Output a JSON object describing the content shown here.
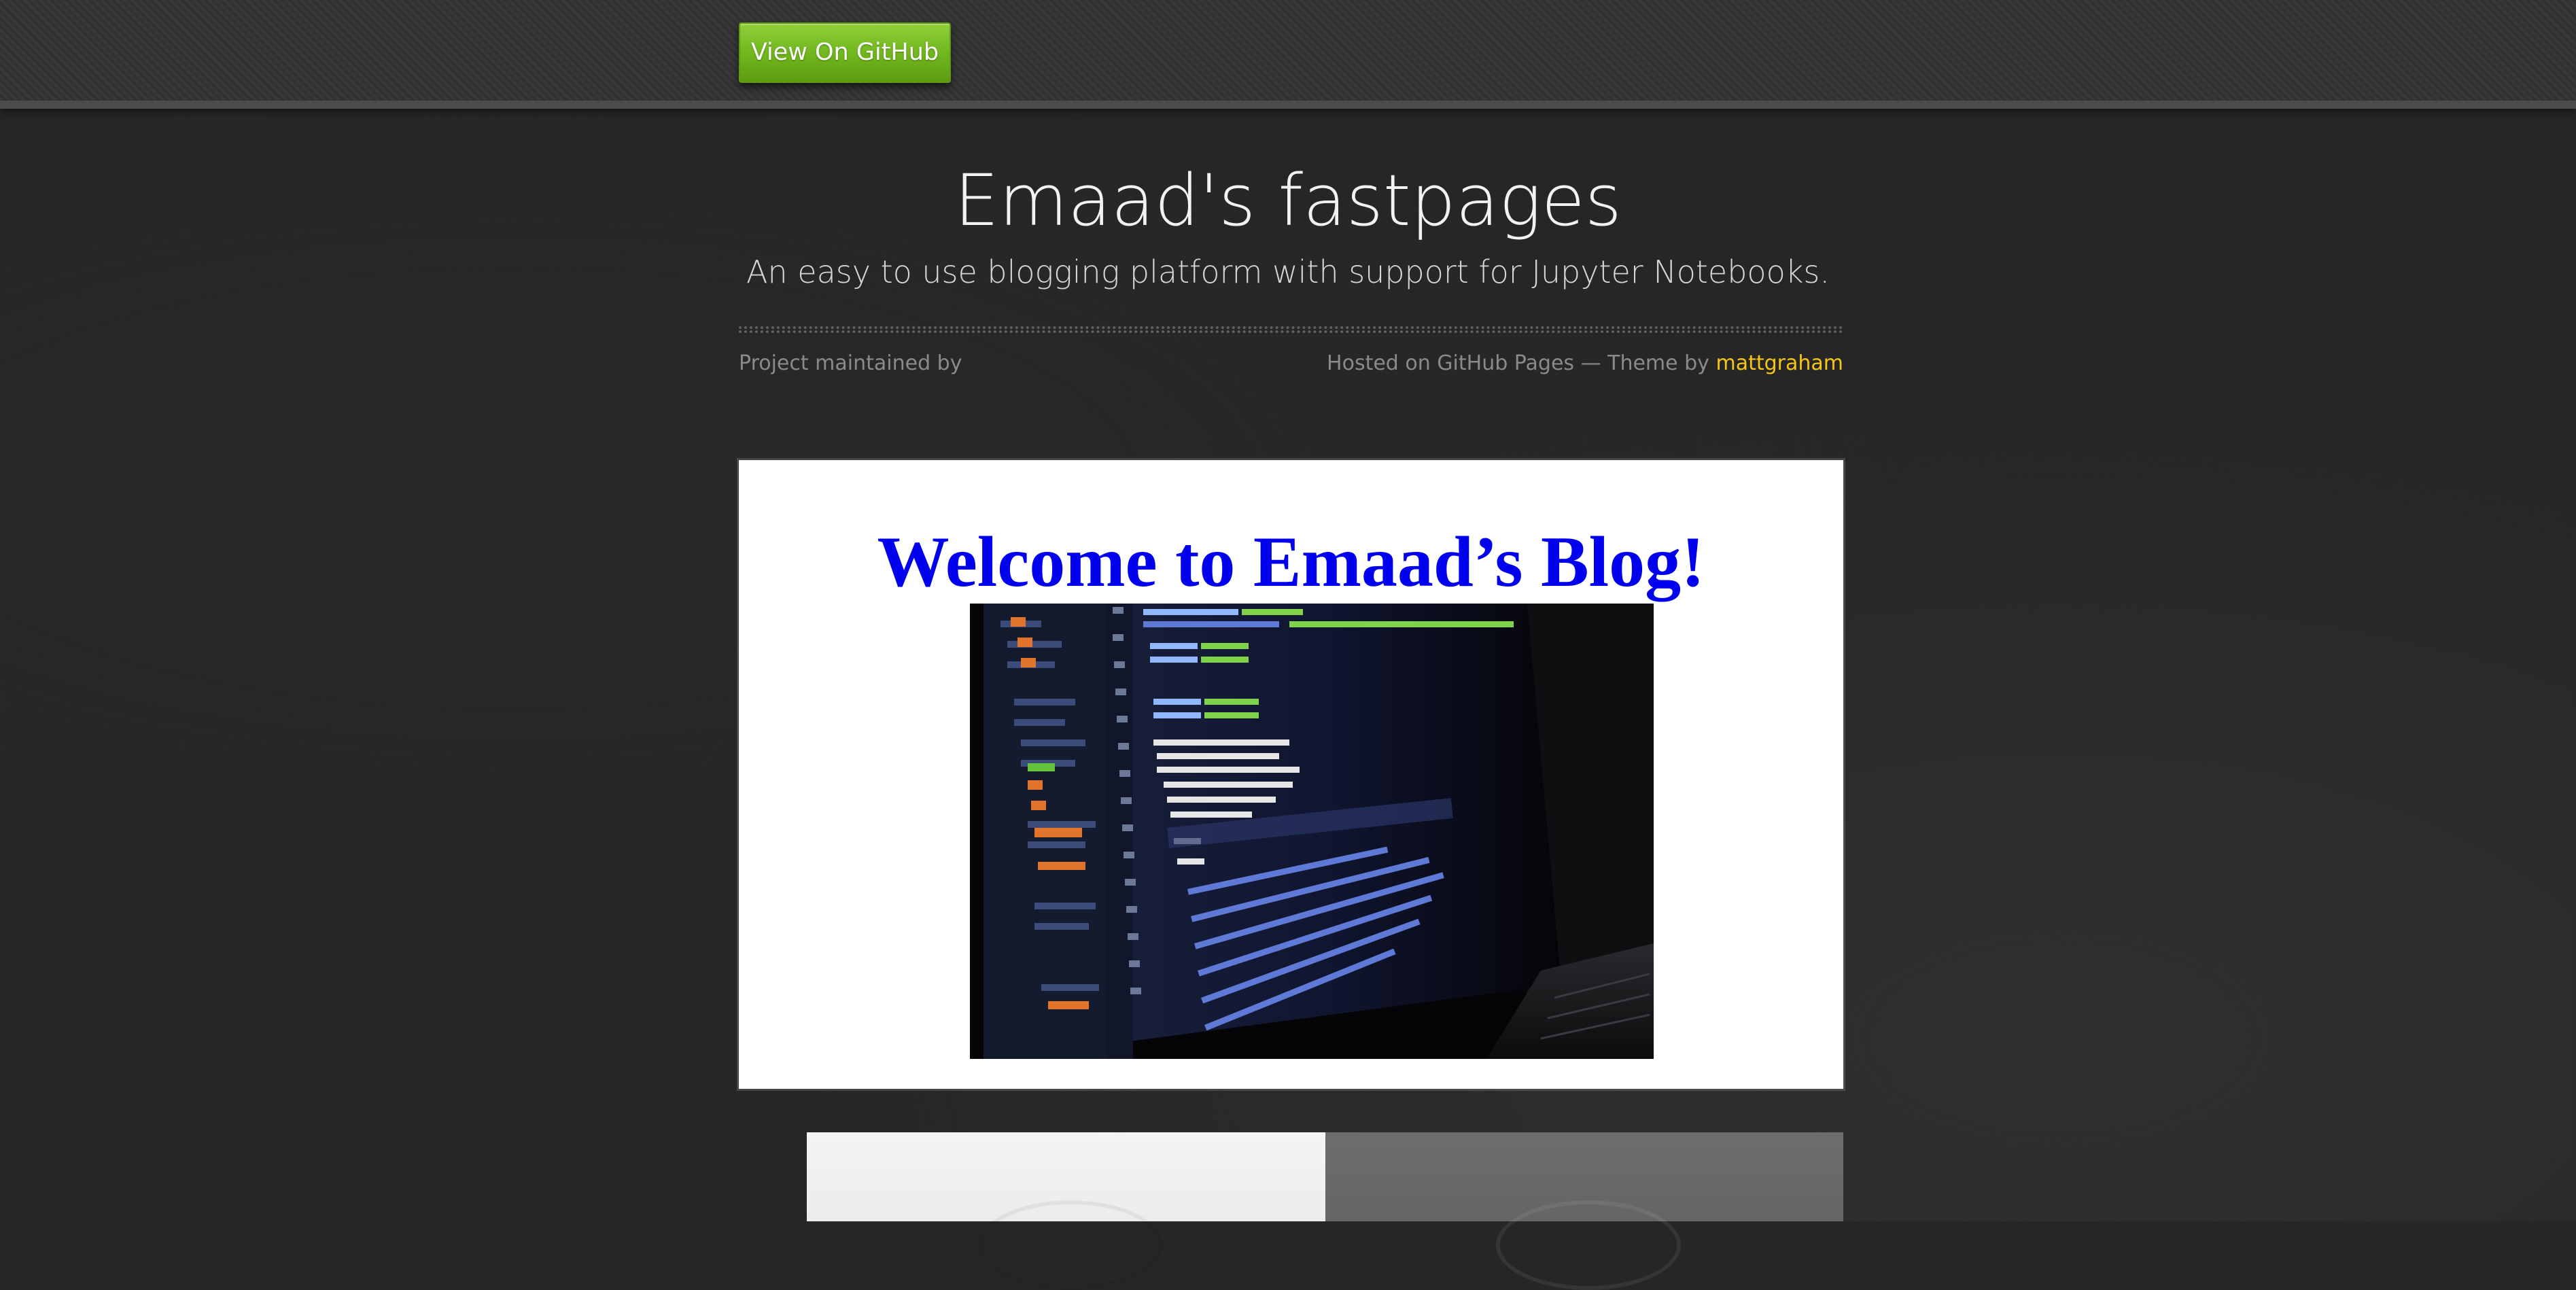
{
  "header": {
    "github_button_label": "View On GitHub"
  },
  "site": {
    "title": "Emaad's fastpages",
    "tagline": "An easy to use blogging platform with support for Jupyter Notebooks.",
    "maintained_by": "Project maintained by",
    "hosted_text": "Hosted on GitHub Pages — Theme by",
    "theme_author": "mattgraham"
  },
  "hero": {
    "heading": "Welcome to Emaad’s Blog!",
    "image": "laptop-code-editor-photo"
  },
  "colors": {
    "page_background": "#262626",
    "header_background": "#333333",
    "button_green": "#6fb51c",
    "link_yellow": "#f5c518",
    "heading_blue": "#0000ee"
  }
}
